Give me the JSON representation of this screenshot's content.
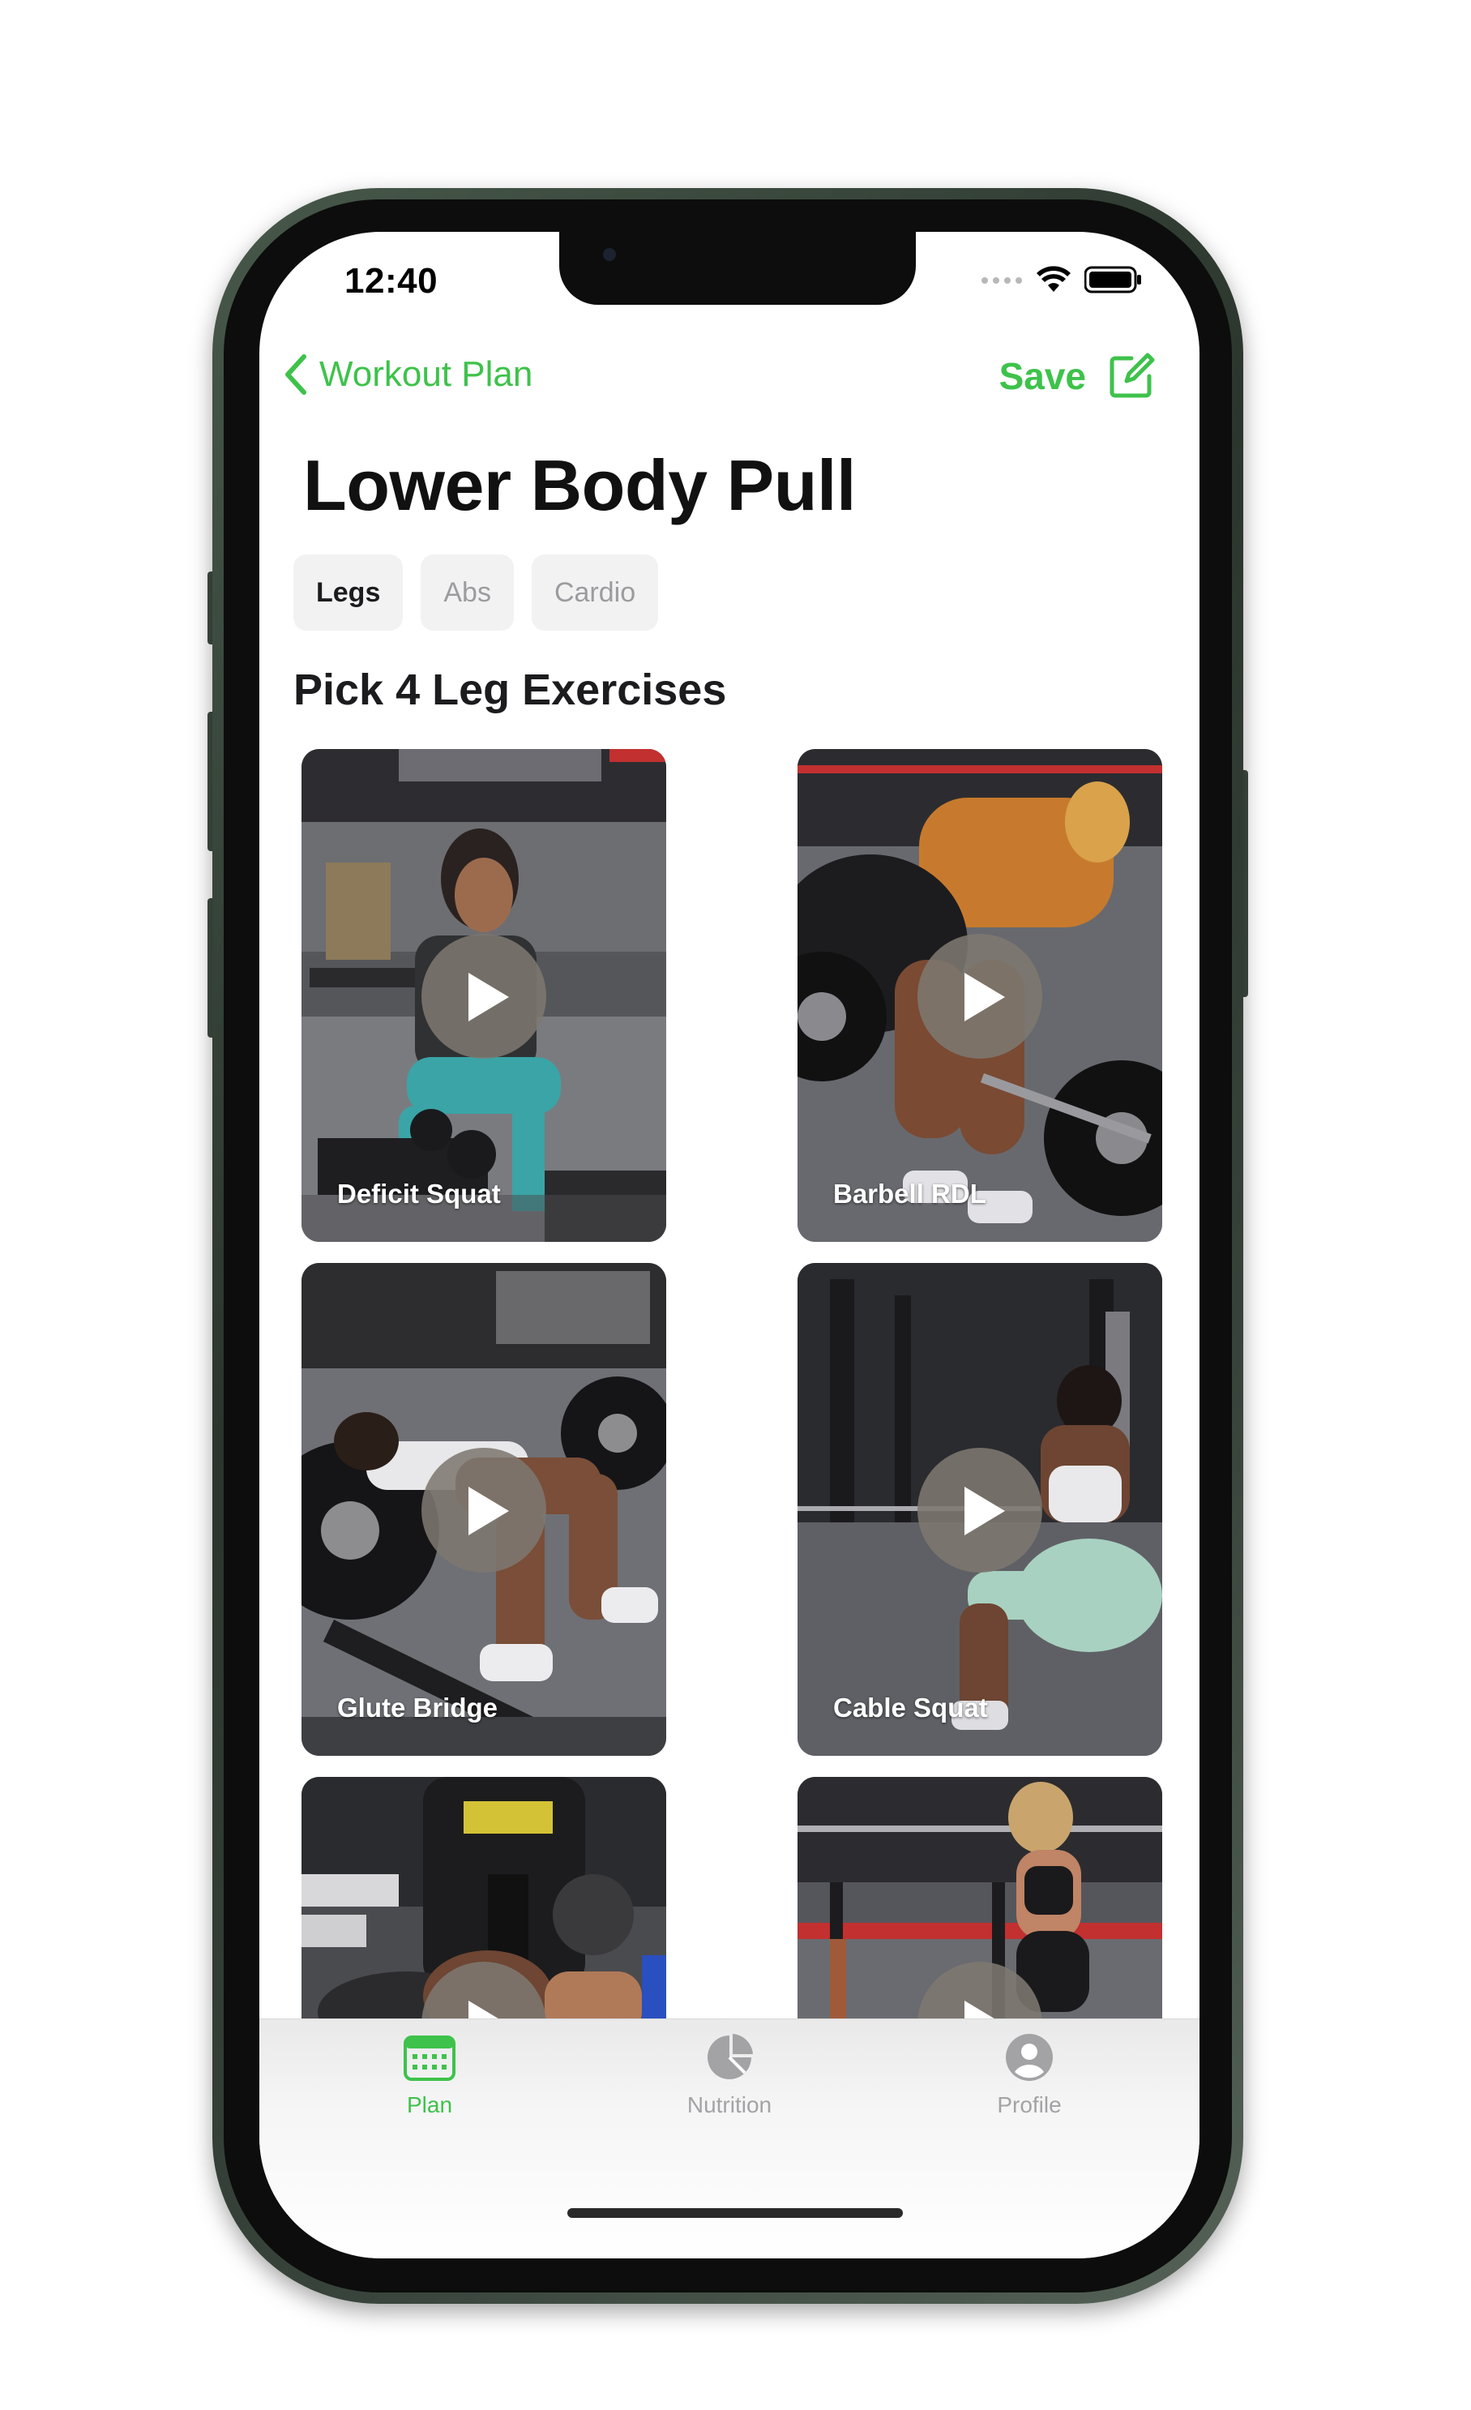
{
  "status_bar": {
    "time": "12:40"
  },
  "nav": {
    "back_label": "Workout Plan",
    "save_label": "Save"
  },
  "page": {
    "title": "Lower Body Pull"
  },
  "chips": [
    {
      "label": "Legs",
      "active": true
    },
    {
      "label": "Abs",
      "active": false
    },
    {
      "label": "Cardio",
      "active": false
    }
  ],
  "section": {
    "title": "Pick 4 Leg Exercises"
  },
  "exercises": [
    {
      "label": "Deficit Squat"
    },
    {
      "label": "Barbell RDL"
    },
    {
      "label": "Glute Bridge"
    },
    {
      "label": "Cable Squat"
    },
    {
      "label": ""
    },
    {
      "label": ""
    }
  ],
  "tabbar": {
    "tabs": [
      {
        "label": "Plan",
        "icon": "calendar-icon",
        "active": true
      },
      {
        "label": "Nutrition",
        "icon": "pie-chart-icon",
        "active": false
      },
      {
        "label": "Profile",
        "icon": "person-circle-icon",
        "active": false
      }
    ]
  },
  "colors": {
    "accent": "#3ec24b",
    "chip_bg": "#f2f2f3",
    "title_text": "#111111",
    "frame": "#2b352d"
  }
}
